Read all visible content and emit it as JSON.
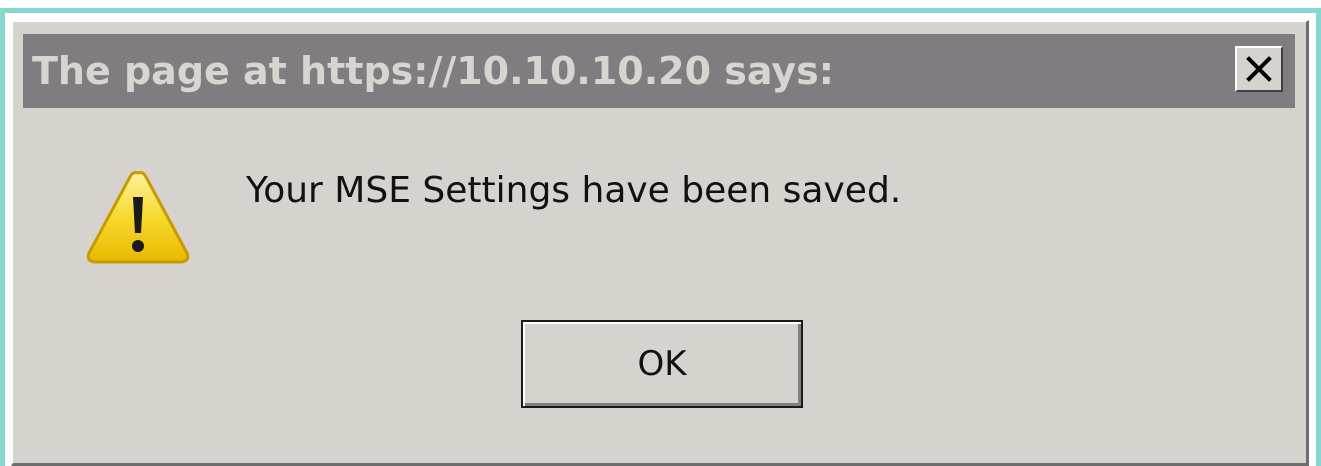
{
  "dialog": {
    "title": "The page at https://10.10.10.20 says:",
    "message": "Your MSE Settings have been saved.",
    "ok_label": "OK",
    "icon": "warning-icon",
    "close_icon": "close-icon"
  },
  "colors": {
    "titlebar": "#7f7d80",
    "title_text": "#d8d5d0",
    "dialog_bg": "#d6d3ce",
    "outer_border": "#84d8d0",
    "warning_fill": "#f5d21a"
  }
}
